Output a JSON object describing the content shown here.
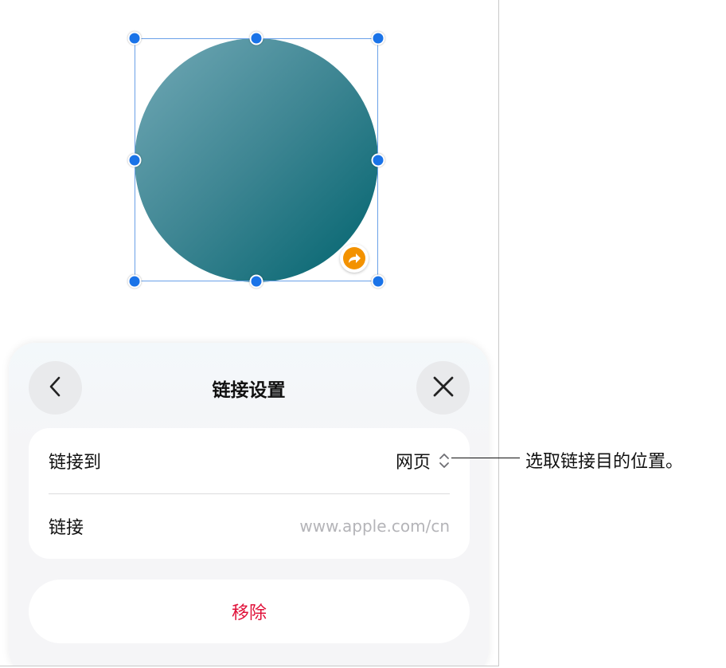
{
  "sheet": {
    "title": "链接设置",
    "link_to_label": "链接到",
    "link_to_value": "网页",
    "link_label": "链接",
    "link_placeholder": "www.apple.com/cn",
    "remove_label": "移除"
  },
  "callout": {
    "text": "选取链接目的位置。"
  },
  "colors": {
    "accent": "#1a73e8",
    "destructive": "#e0123a",
    "link_badge": "#f39200",
    "shape_gradient_start": "#72a9b6",
    "shape_gradient_end": "#00636e"
  },
  "icons": {
    "back": "chevron-left-icon",
    "close": "close-icon",
    "popup": "chevron-up-down-icon",
    "link_badge": "link-arrow-icon"
  }
}
